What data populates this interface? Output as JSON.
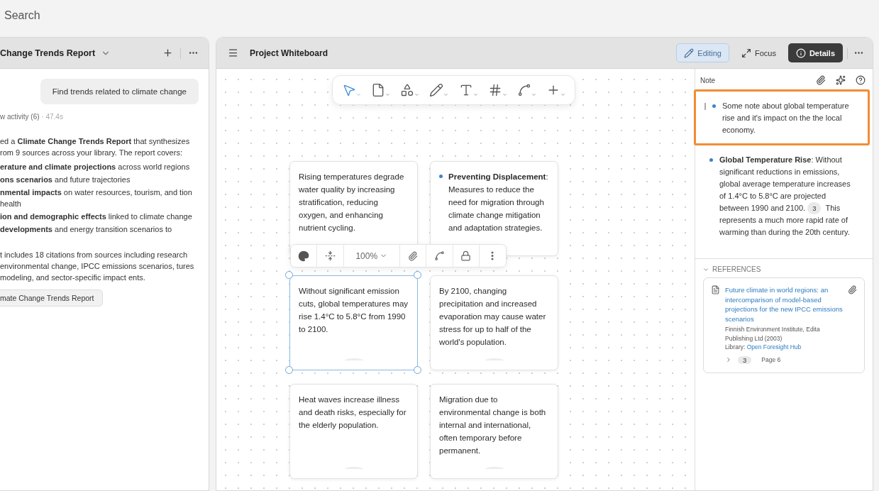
{
  "search": {
    "placeholder": "Search"
  },
  "chat_panel": {
    "title": "Change Trends Report",
    "user_message": "Find trends related to climate change",
    "activity": "w activity (6)",
    "duration": "· 47.4s",
    "intro": "ed a **Climate Change Trends Report** that synthesizes rom 9 sources across your library. The report covers:",
    "bullets": [
      "**erature and climate projections** across world regions",
      "**ons scenarios** and future trajectories",
      "**nmental impacts** on water resources, tourism, and tion health",
      "**ion and demographic effects** linked to climate change",
      "**developments** and energy transition scenarios to"
    ],
    "summary": "t includes 18 citations from sources including research environmental change, IPCC emissions scenarios, tures modeling, and sector-specific impact ents.",
    "report_button": "mate Change Trends Report"
  },
  "whiteboard": {
    "title": "Project Whiteboard",
    "actions": [
      {
        "label": "Editing",
        "kind": "edit",
        "selected": true
      },
      {
        "label": "Focus",
        "kind": "focus",
        "selected": false
      },
      {
        "label": "Details",
        "kind": "details",
        "selected": true
      }
    ],
    "tools": [
      {
        "kind": "select",
        "selected": true
      },
      {
        "kind": "note",
        "selected": false
      },
      {
        "kind": "shapes",
        "selected": false
      },
      {
        "kind": "pen",
        "selected": false
      },
      {
        "kind": "text",
        "selected": false
      },
      {
        "kind": "frame",
        "selected": false
      },
      {
        "kind": "connector",
        "selected": false
      },
      {
        "kind": "add",
        "selected": false
      }
    ],
    "cards": [
      {
        "text": "Rising temperatures degrade water quality by increasing stratification, reducing oxygen, and enhancing nutrient cycling.",
        "bullet": false,
        "selected": false
      },
      {
        "text": "**Preventing Displacement**: Measures to reduce the need for migration through climate change mitigation and adaptation strategies.",
        "bullet": true,
        "selected": false
      },
      {
        "text": "Without significant emission cuts, global temperatures may rise 1.4°C to 5.8°C from 1990 to 2100.",
        "bullet": false,
        "selected": true
      },
      {
        "text": "By 2100, changing precipitation and increased evaporation may cause water stress for up to half of the world's population.",
        "bullet": false,
        "selected": false
      },
      {
        "text": "Heat waves increase illness and death risks, especially for the elderly population.",
        "bullet": false,
        "selected": false
      },
      {
        "text": "Migration due to environmental change is both internal and international, often temporary before permanent.",
        "bullet": false,
        "selected": false
      }
    ],
    "card_toolbar": {
      "zoom": "100%"
    }
  },
  "details": {
    "heading": "Note",
    "notes": [
      {
        "text": "Some note about global temperature rise and it's impact on the the local economy.",
        "editing": true
      },
      {
        "text": "**Global Temperature Rise**: Without significant reductions in emissions, global average temperature increases of 1.4°C to 5.8°C are projected between 1990 and 2100.",
        "citation": "3",
        "text_after": "This represents a much more rapid rate of warming than during the 20th century.",
        "editing": false
      }
    ],
    "references": {
      "heading": "REFERENCES",
      "expanded": true,
      "items": [
        {
          "title": "Future climate in world regions: an intercomparison of model-based projections for the new IPCC emissions scenarios",
          "source": "Finnish Environment Institute, Edita Publishing Ltd (2003)",
          "library_label": "Library:",
          "library": "Open Foresight Hub",
          "citation": "3",
          "page": "Page 6"
        }
      ]
    }
  }
}
